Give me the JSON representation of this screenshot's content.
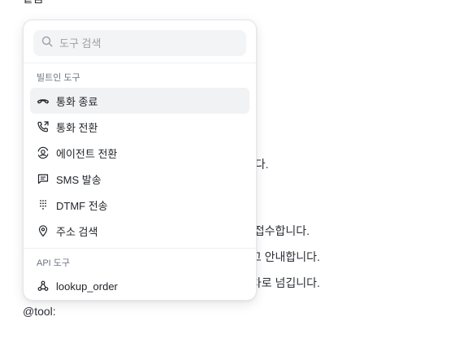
{
  "editor": {
    "top_clip": "같음",
    "line_1": "합니다.",
    "line_2": "를 접수합니다.",
    "line_3": "하고 안내합니다.",
    "line_4": "절차로 넘깁니다.",
    "current_input": "@tool:"
  },
  "popup": {
    "search": {
      "placeholder": "도구 검색",
      "value": ""
    },
    "sections": [
      {
        "label": "빌트인 도구",
        "items": [
          {
            "label": "통화 종료",
            "icon": "hang-up-icon"
          },
          {
            "label": "통화 전환",
            "icon": "phone-forward-icon"
          },
          {
            "label": "에이전트 전환",
            "icon": "agent-transfer-icon"
          },
          {
            "label": "SMS 발송",
            "icon": "message-icon"
          },
          {
            "label": "DTMF 전송",
            "icon": "dialpad-icon"
          },
          {
            "label": "주소 검색",
            "icon": "location-pin-icon"
          }
        ]
      },
      {
        "label": "API 도구",
        "items": [
          {
            "label": "lookup_order",
            "icon": "webhook-icon"
          }
        ]
      }
    ]
  },
  "colors": {
    "active_row": "#f1f2f4",
    "border": "#e4e6ea",
    "muted_text": "#6b7280"
  }
}
